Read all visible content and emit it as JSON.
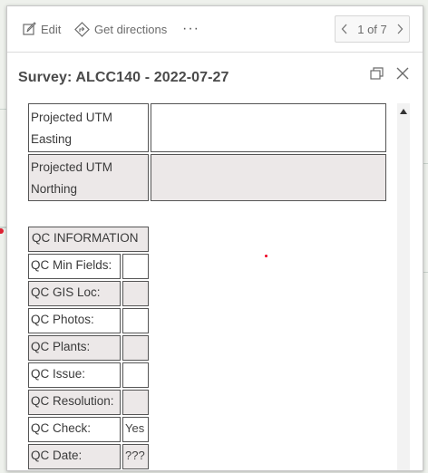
{
  "toolbar": {
    "edit_label": "Edit",
    "directions_label": "Get directions",
    "more_label": "···",
    "pager_label": "1 of 7"
  },
  "popup": {
    "title": "Survey: ALCC140 - 2022-07-27"
  },
  "attributes": {
    "rows_top": [
      {
        "label": "Projected UTM Easting",
        "value": ""
      },
      {
        "label": "Projected UTM Northing",
        "value": ""
      }
    ],
    "qc_header": "QC INFORMATION",
    "qc_rows": [
      {
        "label": "QC Min Fields:",
        "value": ""
      },
      {
        "label": "QC GIS Loc:",
        "value": ""
      },
      {
        "label": "QC Photos:",
        "value": ""
      },
      {
        "label": "QC Plants:",
        "value": ""
      },
      {
        "label": "QC Issue:",
        "value": ""
      },
      {
        "label": "QC Resolution:",
        "value": ""
      },
      {
        "label": "QC Check:",
        "value": "Yes"
      },
      {
        "label": "QC Date:",
        "value": "???"
      }
    ]
  },
  "icons": {
    "edit": "pencil-icon",
    "directions": "directions-icon",
    "more": "ellipsis-icon",
    "prev": "chevron-left-icon",
    "next": "chevron-right-icon",
    "dock": "dock-icon",
    "close": "close-icon"
  },
  "colors": {
    "alt_row": "#ece8e8",
    "border": "#555555",
    "text": "#3a3a3a"
  }
}
